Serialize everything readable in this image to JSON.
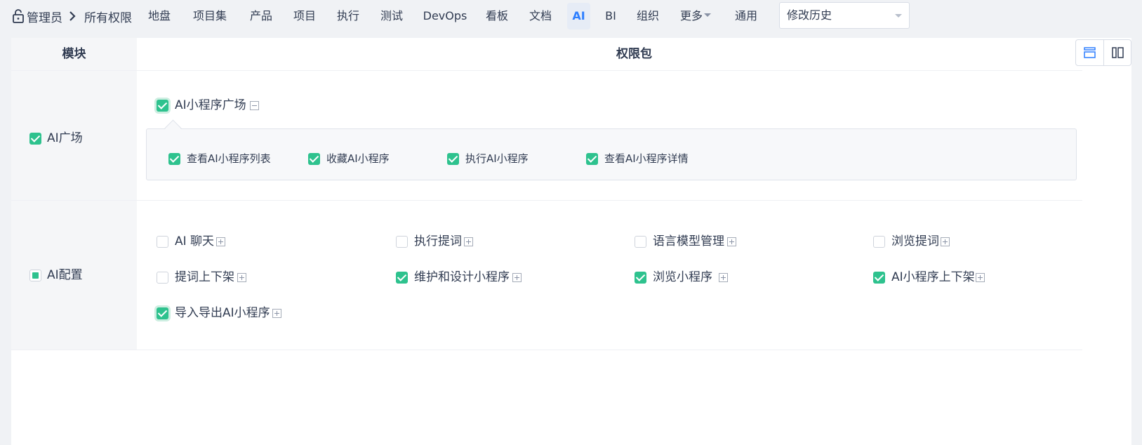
{
  "breadcrumb": {
    "root": "管理员",
    "current": "所有权限",
    "icon": "lock-icon",
    "separator_icon": "chevron-right-icon"
  },
  "nav": {
    "items": [
      "地盘",
      "项目集",
      "产品",
      "项目",
      "执行",
      "测试",
      "DevOps",
      "看板",
      "文档",
      "AI",
      "BI",
      "组织",
      "更多",
      "通用"
    ],
    "active": "AI"
  },
  "history_select": {
    "value": "修改历史"
  },
  "table": {
    "header": {
      "module": "模块",
      "package": "权限包"
    },
    "view_icons": [
      "horizontal-layout-icon",
      "vertical-layout-icon"
    ]
  },
  "modules": [
    {
      "name": "AI广场",
      "state": "checked",
      "packages": [
        {
          "name": "AI小程序广场",
          "checked": true,
          "expanded": true,
          "privileges": [
            {
              "name": "查看AI小程序列表",
              "checked": true
            },
            {
              "name": "收藏AI小程序",
              "checked": true
            },
            {
              "name": "执行AI小程序",
              "checked": true
            },
            {
              "name": "查看AI小程序详情",
              "checked": true
            }
          ]
        }
      ]
    },
    {
      "name": "AI配置",
      "state": "indeterminate",
      "packages": [
        {
          "name": "AI 聊天",
          "checked": false
        },
        {
          "name": "执行提词",
          "checked": false
        },
        {
          "name": "语言模型管理",
          "checked": false
        },
        {
          "name": "浏览提词",
          "checked": false
        },
        {
          "name": "提词上下架",
          "checked": false
        },
        {
          "name": "维护和设计小程序",
          "checked": true
        },
        {
          "name": "浏览小程序",
          "checked": true
        },
        {
          "name": "AI小程序上下架",
          "checked": true
        },
        {
          "name": "导入导出AI小程序",
          "checked": true
        }
      ]
    }
  ],
  "colors": {
    "accent": "#2e7fff",
    "check": "#2ec28e"
  }
}
